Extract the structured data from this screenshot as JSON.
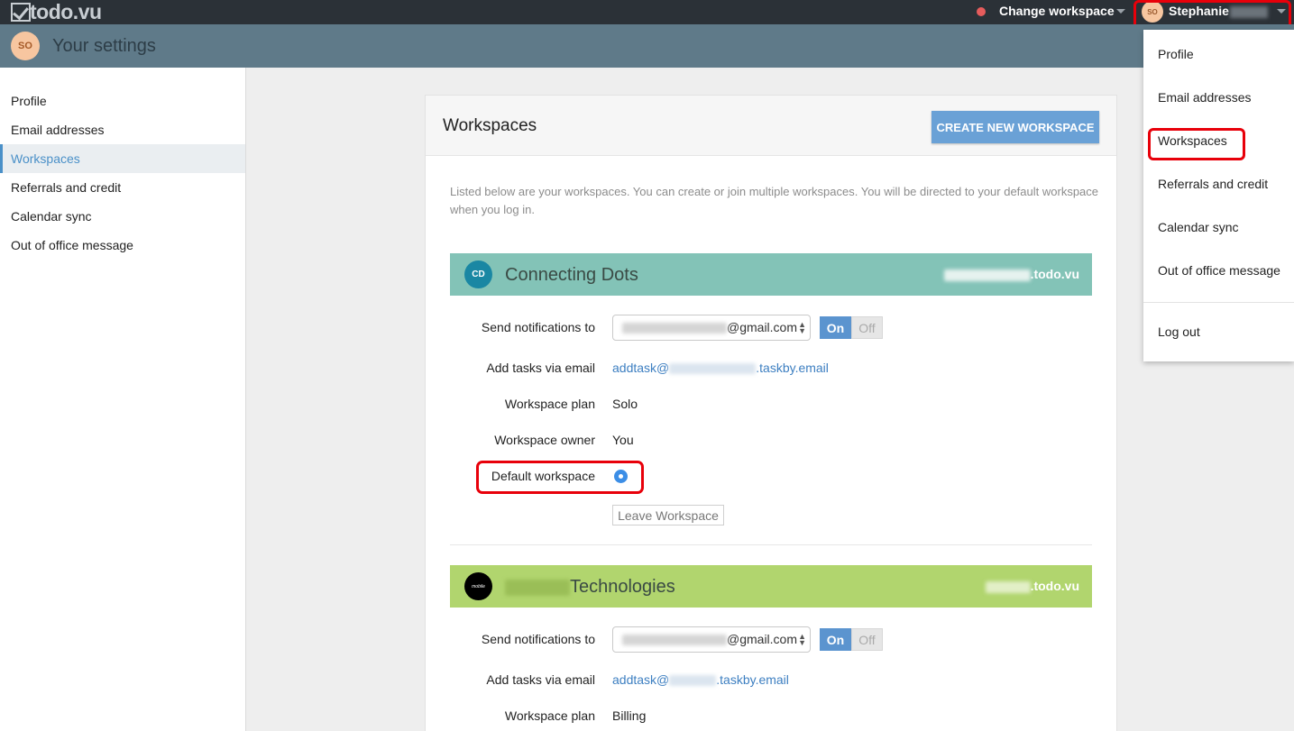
{
  "topbar": {
    "logo": "todo.vu",
    "change_workspace": "Change workspace",
    "user_name": "Stephanie",
    "user_initials": "SO"
  },
  "header": {
    "title": "Your settings",
    "initials": "SO"
  },
  "sidebar": {
    "items": [
      {
        "label": "Profile"
      },
      {
        "label": "Email addresses"
      },
      {
        "label": "Workspaces"
      },
      {
        "label": "Referrals and credit"
      },
      {
        "label": "Calendar sync"
      },
      {
        "label": "Out of office message"
      }
    ],
    "active": "Workspaces"
  },
  "main": {
    "title": "Workspaces",
    "create_button": "CREATE NEW WORKSPACE",
    "description": "Listed below are your workspaces. You can create or join multiple workspaces. You will be directed to your default workspace when you log in."
  },
  "labels": {
    "send_notifications": "Send notifications to",
    "add_tasks": "Add tasks via email",
    "workspace_plan": "Workspace plan",
    "workspace_owner": "Workspace owner",
    "default_workspace": "Default workspace",
    "leave_workspace": "Leave Workspace",
    "toggle_on": "On",
    "toggle_off": "Off"
  },
  "workspaces": [
    {
      "initials": "CD",
      "name": "Connecting Dots",
      "domain_suffix": ".todo.vu",
      "notify_email_suffix": "@gmail.com",
      "add_task_prefix": "addtask@",
      "add_task_suffix": ".taskby.email",
      "plan": "Solo",
      "owner": "You"
    },
    {
      "initials": "mobile",
      "name": "Technologies",
      "domain_suffix": ".todo.vu",
      "notify_email_suffix": "@gmail.com",
      "add_task_prefix": "addtask@",
      "add_task_suffix": ".taskby.email",
      "plan": "Billing"
    }
  ],
  "dropdown": {
    "items": [
      {
        "label": "Profile"
      },
      {
        "label": "Email addresses"
      },
      {
        "label": "Workspaces"
      },
      {
        "label": "Referrals and credit"
      },
      {
        "label": "Calendar sync"
      },
      {
        "label": "Out of office message"
      }
    ],
    "logout": "Log out"
  },
  "colors": {
    "topbar": "#2b3137",
    "header": "#5f7a89",
    "accent": "#4a90c8",
    "highlight_red": "#e8000a",
    "ws1_band": "#83c3b7",
    "ws2_band": "#b1d56e"
  }
}
